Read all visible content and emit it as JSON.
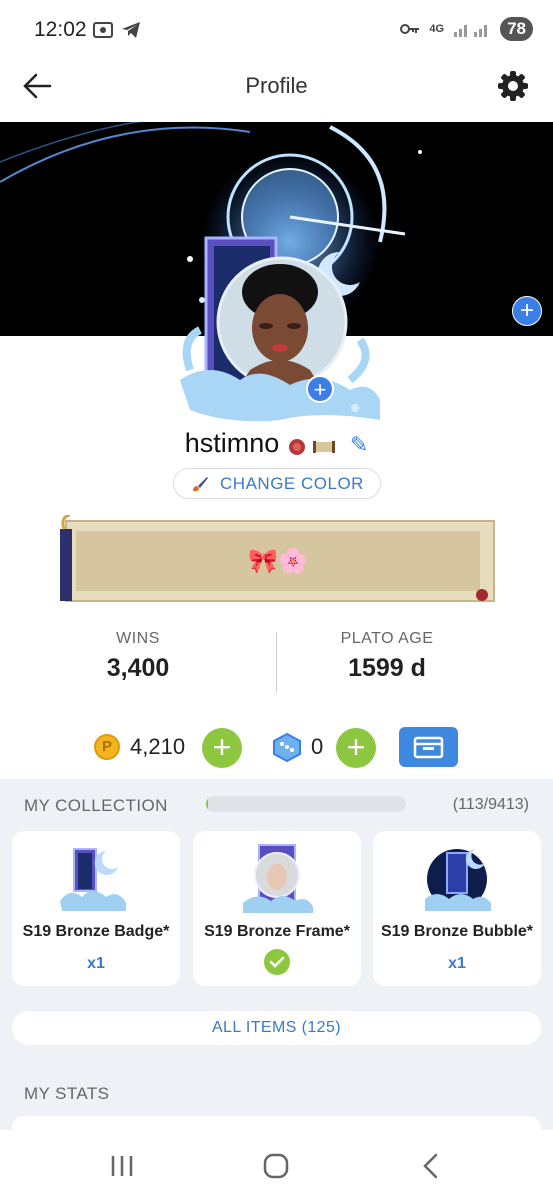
{
  "status_bar": {
    "time": "12:02",
    "battery": "78",
    "network": "4G"
  },
  "header": {
    "title": "Profile",
    "back_icon": "arrow-left-icon",
    "settings_icon": "gear-icon"
  },
  "profile": {
    "username": "hstimno",
    "change_color_label": "CHANGE COLOR",
    "bio_emojis": "🎀🌸"
  },
  "stats": {
    "wins_label": "WINS",
    "wins_value": "3,400",
    "age_label": "PLATO AGE",
    "age_value": "1599 d"
  },
  "currency": {
    "coin_symbol": "P",
    "coins": "4,210",
    "gems": "0"
  },
  "collection": {
    "title": "MY COLLECTION",
    "count": "(113/9413)",
    "progress": 0.012,
    "items": [
      {
        "name": "S19 Bronze Badge*",
        "qty": "x1",
        "equipped": false
      },
      {
        "name": "S19 Bronze Frame*",
        "qty": "",
        "equipped": true
      },
      {
        "name": "S19 Bronze Bubble*",
        "qty": "x1",
        "equipped": false
      }
    ],
    "all_items_label": "ALL ITEMS (125)"
  },
  "my_stats": {
    "title": "MY STATS"
  },
  "colors": {
    "accent_blue": "#3b7ee6",
    "green": "#8dc63f",
    "coin_gold": "#f2b51c"
  }
}
